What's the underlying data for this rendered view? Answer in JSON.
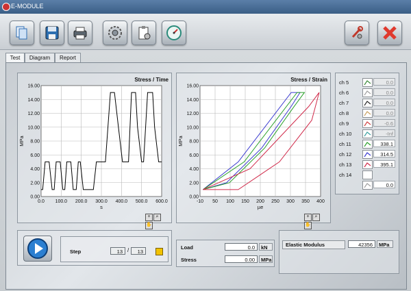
{
  "window": {
    "title": "E-MODULE"
  },
  "toolbar": {
    "buttons": [
      {
        "icon": "documents-icon"
      },
      {
        "icon": "floppy-disk-icon"
      },
      {
        "icon": "printer-icon"
      },
      {
        "icon": "gear-icon"
      },
      {
        "icon": "clipboard-settings-icon"
      },
      {
        "icon": "gauge-icon"
      },
      {
        "icon": "wrench-settings-icon"
      },
      {
        "icon": "close-x-icon"
      }
    ]
  },
  "tabs": [
    {
      "label": "Test",
      "active": true
    },
    {
      "label": "Diagram",
      "active": false
    },
    {
      "label": "Report",
      "active": false
    }
  ],
  "colors": {
    "accent_red": "#e03a2e",
    "curve": "#000000",
    "grid": "#b8b8b8",
    "status_led": "#f2c200"
  },
  "chart_data": [
    {
      "type": "line",
      "title": "Stress / Time",
      "xlabel": "s",
      "ylabel": "MPa",
      "xlim": [
        0,
        600
      ],
      "ylim": [
        0,
        16
      ],
      "xticks": [
        "0.0",
        "100.0",
        "200.0",
        "300.0",
        "400.0",
        "500.0",
        "600.0"
      ],
      "yticks": [
        "0.00",
        "2.00",
        "4.00",
        "6.00",
        "8.00",
        "10.00",
        "12.00",
        "14.00",
        "16.00"
      ],
      "grid": true,
      "series": [
        {
          "color": "#000000",
          "x": [
            0,
            8,
            20,
            40,
            55,
            65,
            75,
            95,
            108,
            118,
            128,
            148,
            160,
            175,
            185,
            195,
            210,
            225,
            230,
            245,
            255,
            260,
            275,
            290,
            300,
            320,
            345,
            365,
            385,
            405,
            435,
            450,
            470,
            480,
            500,
            510,
            530,
            555,
            565,
            585,
            600
          ],
          "y": [
            1,
            1,
            5,
            5,
            1,
            1,
            5,
            5,
            1,
            1,
            5,
            5,
            1,
            1,
            5,
            5,
            1,
            1,
            1,
            1,
            1,
            1,
            5,
            5,
            5,
            5,
            15,
            15,
            10,
            5,
            5,
            15,
            15,
            10,
            5,
            5,
            15,
            15,
            10,
            5,
            5
          ]
        }
      ]
    },
    {
      "type": "line",
      "title": "Stress / Strain",
      "xlabel": "µe",
      "ylabel": "MPa",
      "xlim": [
        -10,
        400
      ],
      "ylim": [
        0,
        16
      ],
      "xticks": [
        "-10",
        "50",
        "100",
        "150",
        "200",
        "250",
        "300",
        "350",
        "400"
      ],
      "yticks": [
        "0.00",
        "2.00",
        "4.00",
        "6.00",
        "8.00",
        "10.00",
        "12.00",
        "14.00",
        "16.00"
      ],
      "grid": true,
      "series": [
        {
          "color": "#3a3ad0",
          "x": [
            0,
            120,
            300,
            330,
            300,
            200,
            80,
            0
          ],
          "y": [
            1,
            5,
            15,
            15,
            13,
            7,
            2,
            1
          ]
        },
        {
          "color": "#2aa02a",
          "x": [
            0,
            140,
            320,
            345,
            310,
            210,
            90,
            0
          ],
          "y": [
            1,
            5,
            15,
            15,
            13,
            7,
            2,
            1
          ]
        },
        {
          "color": "#d02a4a",
          "x": [
            0,
            160,
            360,
            395,
            370,
            260,
            120,
            0
          ],
          "y": [
            1,
            4,
            13,
            15,
            11,
            5,
            1,
            1
          ]
        }
      ]
    }
  ],
  "channels": [
    {
      "label": "ch 5",
      "color": "#3a8a3a",
      "value": "0.0",
      "active": false
    },
    {
      "label": "ch 6",
      "color": "#a0a0a0",
      "value": "0.0",
      "active": false
    },
    {
      "label": "ch 7",
      "color": "#2a2a2a",
      "value": "0.0",
      "active": false
    },
    {
      "label": "ch 8",
      "color": "#c8a060",
      "value": "0.0",
      "active": false
    },
    {
      "label": "ch 9",
      "color": "#d04040",
      "value": "-0.6",
      "active": false
    },
    {
      "label": "ch 10",
      "color": "#3aa0a0",
      "value": "-Inf",
      "active": false
    },
    {
      "label": "ch 11",
      "color": "#2aa02a",
      "value": "338.1",
      "active": true
    },
    {
      "label": "ch 12",
      "color": "#3a3ad0",
      "value": "314.5",
      "active": true
    },
    {
      "label": "ch 13",
      "color": "#d02a4a",
      "value": "395.1",
      "active": true
    },
    {
      "label": "ch 14",
      "color": "#ffffff",
      "value": "",
      "active": false
    },
    {
      "label": "",
      "color": "#a0a0a0",
      "value": "0.0",
      "active": true
    }
  ],
  "bottom": {
    "step_label": "Step",
    "step_current": "13",
    "step_total": "13",
    "load_label": "Load",
    "load_value": "0.0",
    "load_unit": "kN",
    "stress_label": "Stress",
    "stress_value": "0.00",
    "stress_unit": "MPa",
    "elastic_label": "Elastic Modulus",
    "elastic_value": "42356",
    "elastic_unit": "MPa"
  }
}
